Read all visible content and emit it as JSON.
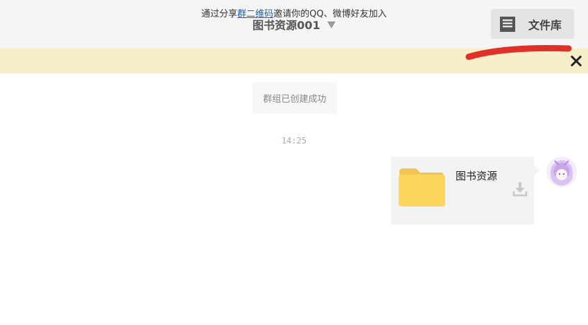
{
  "header": {
    "group_title": "图书资源001",
    "library_label": "文件库"
  },
  "banner": {
    "text_before": "通过分享",
    "link_text": "群二维码",
    "text_after": "邀请你的QQ、微博好友加入"
  },
  "chat": {
    "system_message": "群组已创建成功",
    "timestamp": "14:25",
    "file_message": {
      "name": "图书资源"
    }
  },
  "colors": {
    "header_bg": "#f5f5f5",
    "banner_bg": "#f7efc8",
    "link": "#1a5fb4",
    "folder": "#fcd34d",
    "annotation_stroke": "#e0302a"
  }
}
